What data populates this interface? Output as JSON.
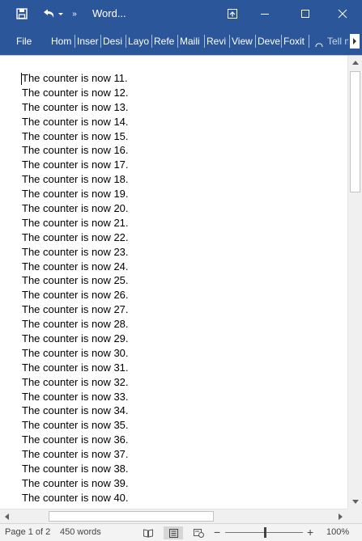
{
  "titlebar": {
    "title": "Word...",
    "more_glyph": "»",
    "icons": [
      "save-icon",
      "undo-icon",
      "undo-dropdown-icon",
      "customize-qat-icon",
      "ribbon-display-options-icon",
      "minimize-icon",
      "maximize-icon",
      "close-icon"
    ]
  },
  "ribbon": {
    "tabs": [
      {
        "label": "File"
      },
      {
        "label": "Hom"
      },
      {
        "label": "Inser"
      },
      {
        "label": "Desi"
      },
      {
        "label": "Layo"
      },
      {
        "label": "Refe"
      },
      {
        "label": "Maili"
      },
      {
        "label": "Revi"
      },
      {
        "label": "View"
      },
      {
        "label": "Deve"
      },
      {
        "label": "Foxit"
      },
      {
        "label": "Tell m"
      }
    ],
    "tell_me_icon": "lightbulb-icon"
  },
  "document": {
    "lines": [
      "The counter is now 11.",
      "The counter is now 12.",
      "The counter is now 13.",
      "The counter is now 14.",
      "The counter is now 15.",
      "The counter is now 16.",
      "The counter is now 17.",
      "The counter is now 18.",
      "The counter is now 19.",
      "The counter is now 20.",
      "The counter is now 21.",
      "The counter is now 22.",
      "The counter is now 23.",
      "The counter is now 24.",
      "The counter is now 25.",
      "The counter is now 26.",
      "The counter is now 27.",
      "The counter is now 28.",
      "The counter is now 29.",
      "The counter is now 30.",
      "The counter is now 31.",
      "The counter is now 32.",
      "The counter is now 33.",
      "The counter is now 34.",
      "The counter is now 35.",
      "The counter is now 36.",
      "The counter is now 37.",
      "The counter is now 38.",
      "The counter is now 39.",
      "The counter is now 40."
    ]
  },
  "statusbar": {
    "page": "Page 1 of 2",
    "words": "450 words",
    "zoom": "100%",
    "zoom_minus": "−",
    "zoom_plus": "+",
    "zoom_level": 1.0
  },
  "colors": {
    "accent": "#2b579a",
    "statusbar_bg": "#f3f3f3",
    "document_bg": "#ffffff"
  }
}
